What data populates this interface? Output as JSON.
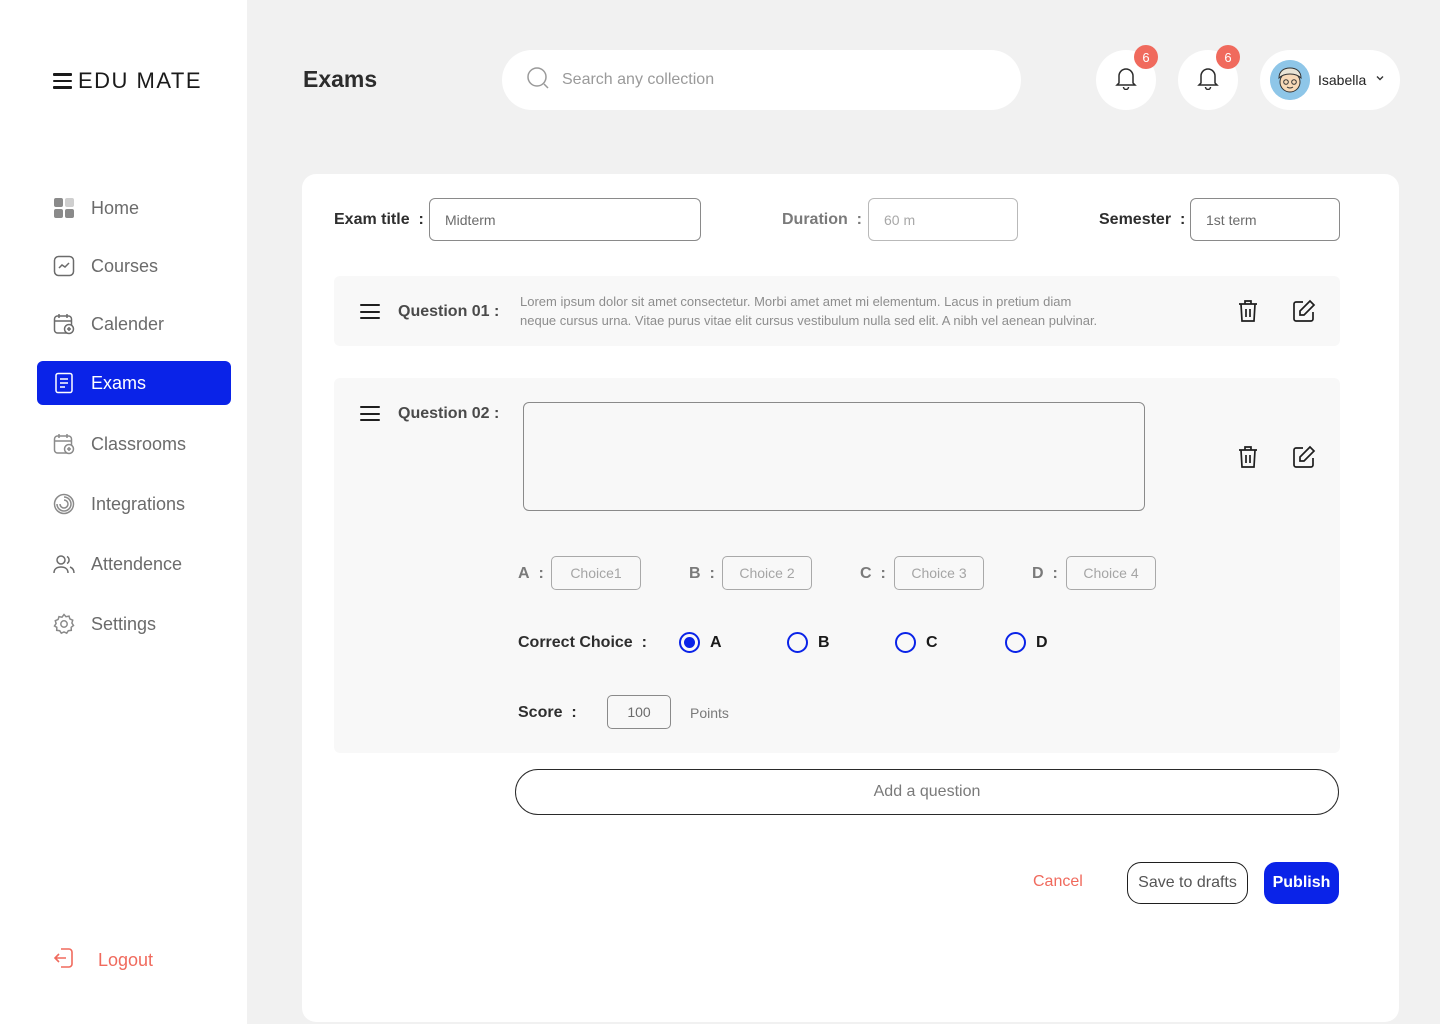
{
  "app": {
    "brand": "EDU MATE"
  },
  "sidebar": {
    "items": [
      {
        "label": "Home",
        "icon": "grid-icon"
      },
      {
        "label": "Courses",
        "icon": "chart-icon"
      },
      {
        "label": "Calender",
        "icon": "calendar-icon"
      },
      {
        "label": "Exams",
        "icon": "document-icon",
        "active": true
      },
      {
        "label": "Classrooms",
        "icon": "calendar-add-icon"
      },
      {
        "label": "Integrations",
        "icon": "spiral-icon"
      },
      {
        "label": "Attendence",
        "icon": "users-icon"
      },
      {
        "label": "Settings",
        "icon": "gear-icon"
      }
    ],
    "logout": "Logout"
  },
  "header": {
    "title": "Exams",
    "search_placeholder": "Search any collection",
    "notifications": [
      {
        "count": "6"
      },
      {
        "count": "6"
      }
    ],
    "user": {
      "name": "Isabella"
    }
  },
  "form": {
    "exam_title_label": "Exam title",
    "exam_title_value": "Midterm",
    "duration_label": "Duration",
    "duration_placeholder": "60 m",
    "semester_label": "Semester",
    "semester_value": "1st term",
    "colon": ":"
  },
  "questions": [
    {
      "label": "Question 01 :",
      "text_line1": "Lorem ipsum dolor sit amet consectetur. Morbi amet amet mi elementum. Lacus in pretium diam",
      "text_line2": "neque cursus urna. Vitae purus vitae elit cursus vestibulum nulla sed elit. A nibh vel aenean pulvinar."
    },
    {
      "label": "Question 02 :",
      "choices": [
        {
          "letter": "A",
          "placeholder": "Choice1"
        },
        {
          "letter": "B",
          "placeholder": "Choice 2"
        },
        {
          "letter": "C",
          "placeholder": "Choice 3"
        },
        {
          "letter": "D",
          "placeholder": "Choice 4"
        }
      ],
      "correct_label": "Correct Choice",
      "correct_options": [
        "A",
        "B",
        "C",
        "D"
      ],
      "correct_selected": "A",
      "score_label": "Score",
      "score_value": "100",
      "score_unit": "Points"
    }
  ],
  "actions": {
    "add_question": "Add a question",
    "cancel": "Cancel",
    "save_drafts": "Save to drafts",
    "publish": "Publish"
  },
  "colors": {
    "accent": "#0a23e8",
    "danger": "#f06a5d",
    "background": "#f1f1f1"
  }
}
